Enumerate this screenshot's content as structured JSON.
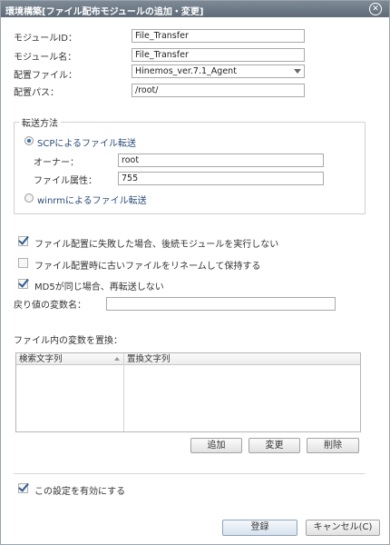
{
  "title": "環境構築[ファイル配布モジュールの追加・変更]",
  "fields": {
    "module_id": {
      "label": "モジュールID：",
      "value": "File_Transfer"
    },
    "module_name": {
      "label": "モジュール名：",
      "value": "File_Transfer"
    },
    "deploy_file": {
      "label": "配置ファイル：",
      "value": "Hinemos_ver.7.1_Agent"
    },
    "deploy_path": {
      "label": "配置パス：",
      "value": "/root/"
    }
  },
  "transfer": {
    "legend": "転送方法",
    "scp_label": "SCPによるファイル転送",
    "owner_label": "オーナー：",
    "owner_value": "root",
    "attr_label": "ファイル属性：",
    "attr_value": "755",
    "winrm_label": "winrmによるファイル転送",
    "selected": "scp"
  },
  "options": [
    {
      "label": "ファイル配置に失敗した場合、後続モジュールを実行しない",
      "checked": true
    },
    {
      "label": "ファイル配置時に古いファイルをリネームして保持する",
      "checked": false
    },
    {
      "label": "MD5が同じ場合、再転送しない",
      "checked": true
    }
  ],
  "return_var": {
    "label": "戻り値の変数名：",
    "value": ""
  },
  "replace": {
    "label": "ファイル内の変数を置換：",
    "columns": [
      "検索文字列",
      "置換文字列"
    ],
    "add": "追加",
    "edit": "変更",
    "delete": "削除"
  },
  "enable": {
    "label": "この設定を有効にする",
    "checked": true
  },
  "footer": {
    "ok": "登録",
    "cancel": "キャンセル(C)"
  }
}
